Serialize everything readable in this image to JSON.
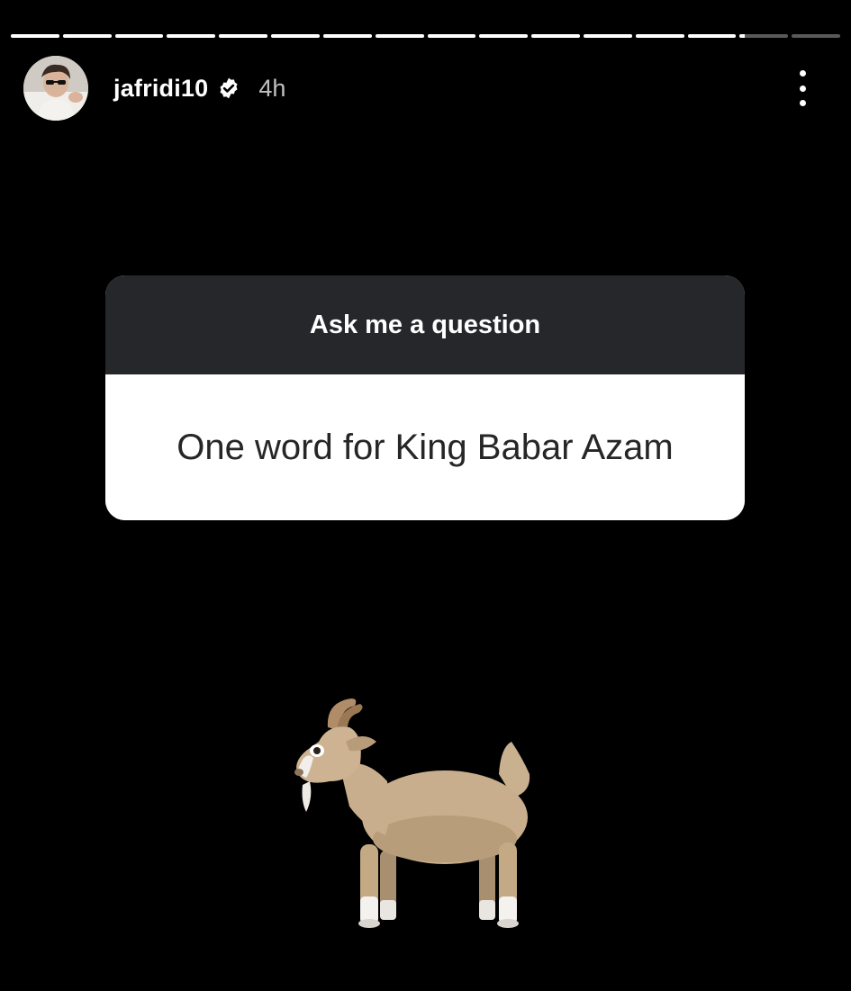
{
  "story": {
    "progress": {
      "segment_count": 16,
      "viewed_count": 14,
      "current_progress": 0.1
    },
    "header": {
      "username": "jafridi10",
      "verified": true,
      "time_ago": "4h",
      "avatar_icon": "profile-avatar",
      "more_icon": "more-vertical-icon"
    },
    "question_sticker": {
      "prompt": "Ask me a question",
      "answer": "One word for King Babar Azam"
    },
    "sticker": {
      "icon": "goat-emoji"
    }
  },
  "colors": {
    "background": "#000000",
    "sticker_header": "#25272b",
    "sticker_body": "#ffffff",
    "verified_badge": "#ffffff"
  }
}
